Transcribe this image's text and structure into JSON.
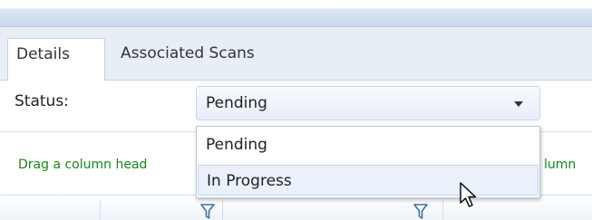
{
  "tabs": [
    {
      "label": "Details",
      "active": true
    },
    {
      "label": "Associated Scans",
      "active": false
    }
  ],
  "status": {
    "label": "Status:",
    "selected": "Pending",
    "options": [
      "Pending",
      "In Progress"
    ],
    "highlighted_option": "In Progress"
  },
  "grid": {
    "group_hint_left": "Drag a column head",
    "group_hint_right": "lumn",
    "filter_icon": "filter-icon"
  },
  "colors": {
    "accent_green": "#138a13",
    "selection_bg": "#eaf1fa",
    "border_blue": "#b7c8df"
  }
}
